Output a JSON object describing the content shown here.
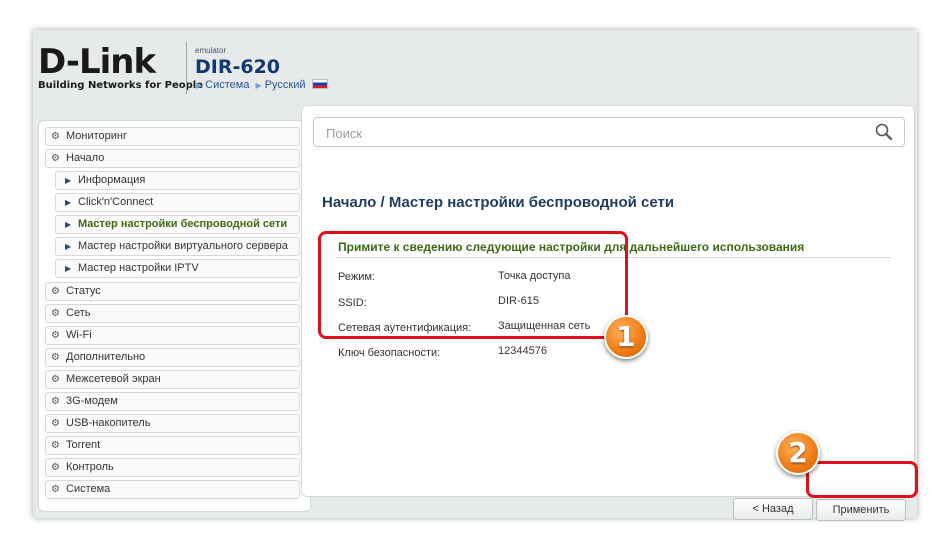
{
  "header": {
    "logo": "D-Link",
    "tagline": "Building Networks for People",
    "emulator": "emulator",
    "model": "DIR-620",
    "breadcrumb_system": "Система",
    "breadcrumb_language": "Русский"
  },
  "sidebar": {
    "items": [
      {
        "label": "Мониторинг"
      },
      {
        "label": "Начало"
      },
      {
        "label": "Информация"
      },
      {
        "label": "Click'n'Connect"
      },
      {
        "label": "Мастер настройки беспроводной сети"
      },
      {
        "label": "Мастер настройки виртуального сервера"
      },
      {
        "label": "Мастер настройки IPTV"
      },
      {
        "label": "Статус"
      },
      {
        "label": "Сеть"
      },
      {
        "label": "Wi-Fi"
      },
      {
        "label": "Дополнительно"
      },
      {
        "label": "Межсетевой экран"
      },
      {
        "label": "3G-модем"
      },
      {
        "label": "USB-накопитель"
      },
      {
        "label": "Torrent"
      },
      {
        "label": "Контроль"
      },
      {
        "label": "Система"
      }
    ]
  },
  "search": {
    "placeholder": "Поиск"
  },
  "main": {
    "title": "Начало /  Мастер настройки беспроводной сети",
    "section_title": "Примите к сведению следующие настройки для дальнейшего использования",
    "rows": [
      {
        "label": "Режим:",
        "value": "Точка доступа"
      },
      {
        "label": "SSID:",
        "value": "DIR-615"
      },
      {
        "label": "Сетевая аутентификация:",
        "value": "Защищенная сеть"
      },
      {
        "label": "Ключ безопасности:",
        "value": "12344576"
      }
    ],
    "back_label": "< Назад",
    "apply_label": "Применить"
  },
  "annotations": {
    "badge1": "1",
    "badge2": "2",
    "color": "#e0111c",
    "badge_color": "#f07a13"
  }
}
